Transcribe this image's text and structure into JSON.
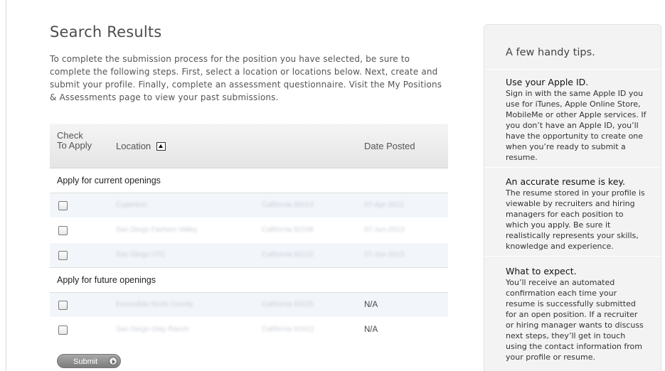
{
  "main": {
    "title": "Search Results",
    "intro": "To complete the submission process for the position you have selected, be sure to complete the following steps. First, select a location or locations below. Next, create and submit your profile. Finally, complete an assessment questionnaire. Visit the My Positions & Assessments page to view your past submissions."
  },
  "table": {
    "headers": {
      "check": "Check To Apply",
      "location": "Location",
      "date": "Date Posted"
    },
    "sort_icon": "sort-ascending-icon",
    "current_group": "Apply for current openings",
    "future_group": "Apply for future openings",
    "current_rows": [
      {
        "location": "Cupertino",
        "region": "California 95014",
        "date": "07-Apr-2013"
      },
      {
        "location": "San Diego Fashion Valley",
        "region": "California 92108",
        "date": "07-Jun-2013"
      },
      {
        "location": "San Diego UTC",
        "region": "California 92122",
        "date": "07-Jun-2013"
      }
    ],
    "future_rows": [
      {
        "location": "Escondido North County",
        "region": "California 92025",
        "date": "N/A"
      },
      {
        "location": "San Diego Otay Ranch",
        "region": "California 91913",
        "date": "N/A"
      }
    ]
  },
  "submit_label": "Submit",
  "tips": {
    "title": "A few handy tips.",
    "items": [
      {
        "heading": "Use your Apple ID.",
        "body": "Sign in with the same Apple ID you use for iTunes, Apple Online Store, MobileMe or other Apple services. If you don’t have an Apple ID, you’ll have the opportunity to create one when you’re ready to submit a resume."
      },
      {
        "heading": "An accurate resume is key.",
        "body": "The resume stored in your profile is viewable by recruiters and hiring managers for each position to which you apply. Be sure it realistically represents your skills, knowledge and experience."
      },
      {
        "heading": "What to expect.",
        "body": "You’ll receive an automated confirmation each time your resume is successfully submitted for an open position. If a recruiter or hiring manager wants to discuss next steps, they’ll get in touch using the contact information from your profile or resume."
      }
    ]
  }
}
